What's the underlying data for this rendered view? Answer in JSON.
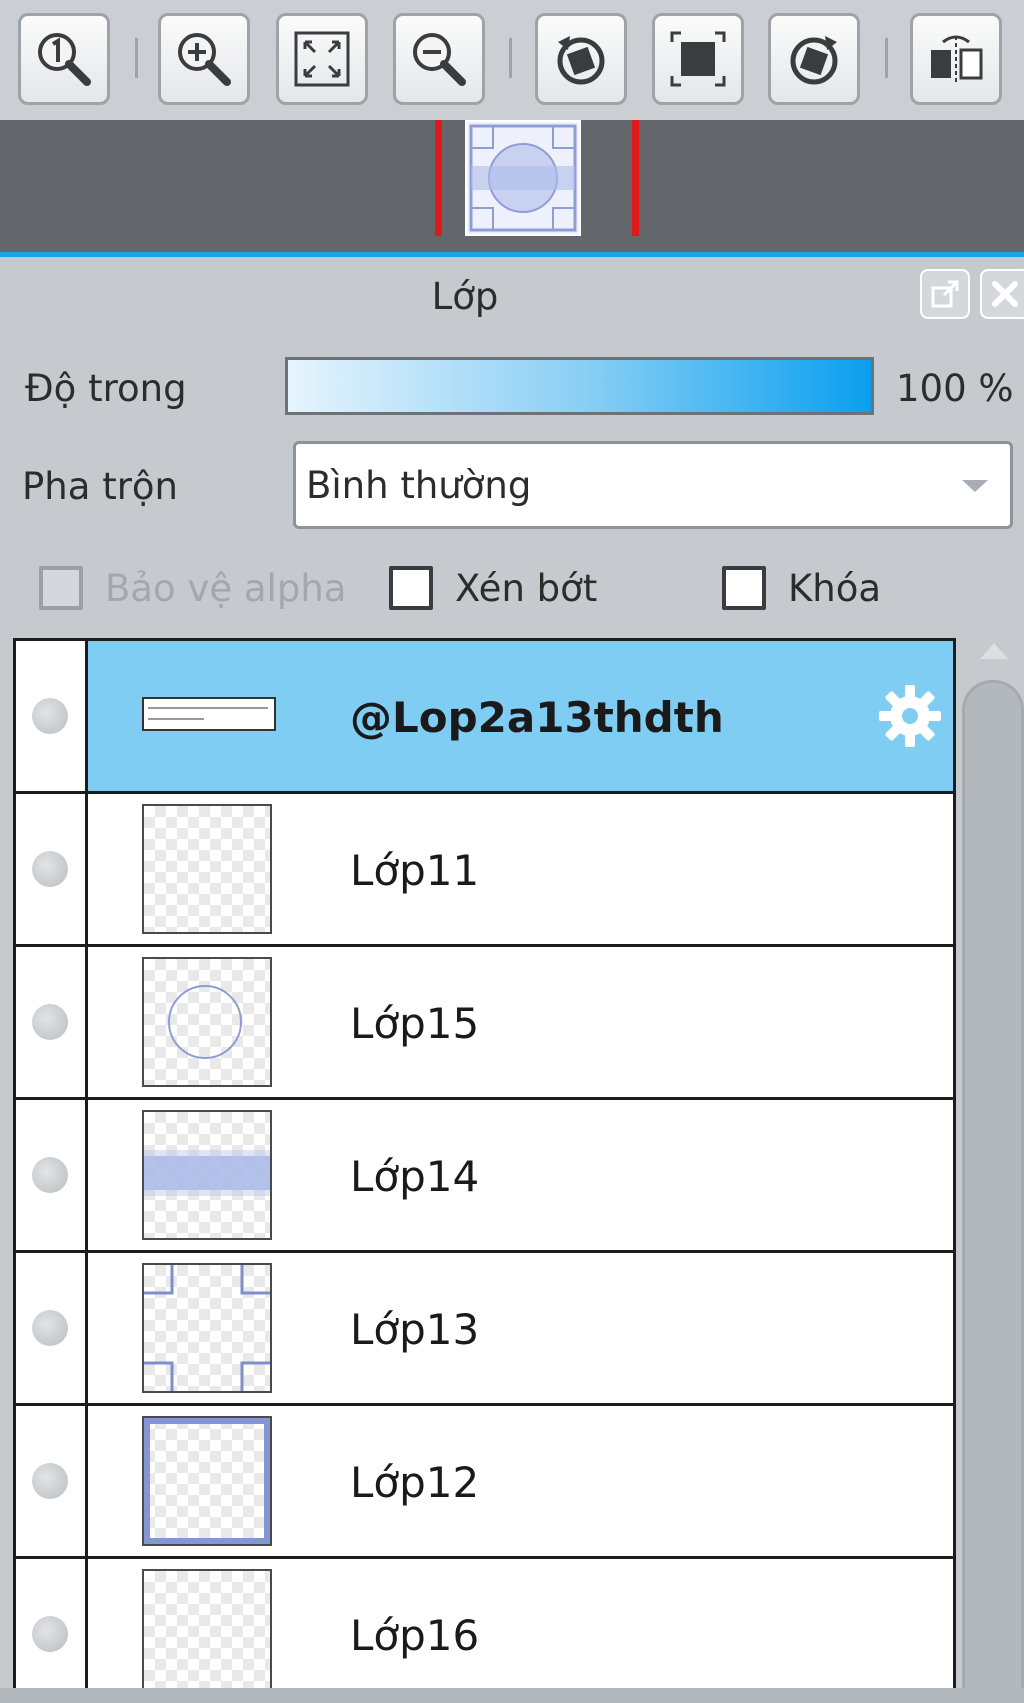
{
  "toolbar": {
    "buttons": [
      {
        "name": "zoom-actual-size-icon"
      },
      {
        "name": "zoom-in-icon"
      },
      {
        "name": "fit-to-window-icon"
      },
      {
        "name": "zoom-out-icon"
      },
      {
        "name": "rotate-left-icon"
      },
      {
        "name": "reset-rotation-icon"
      },
      {
        "name": "rotate-right-icon"
      },
      {
        "name": "flip-horizontal-icon"
      }
    ]
  },
  "panel": {
    "title": "Lớp",
    "opacity_label": "Độ trong",
    "opacity_value": "100 %",
    "opacity_fraction": 1.0,
    "blend_label": "Pha trộn",
    "blend_value": "Bình thường",
    "protect_alpha_label": "Bảo vệ alpha",
    "clip_label": "Xén bớt",
    "lock_label": "Khóa"
  },
  "colors": {
    "selected_row": "#7fcdf3",
    "accent_blue": "#1aa3e8",
    "marker_red": "#e0191d"
  },
  "layers": [
    {
      "name": "@Lop2a13thdth",
      "selected": true,
      "thumb": "text-thumb"
    },
    {
      "name": "Lớp11",
      "selected": false,
      "thumb": "empty"
    },
    {
      "name": "Lớp15",
      "selected": false,
      "thumb": "circle"
    },
    {
      "name": "Lớp14",
      "selected": false,
      "thumb": "band"
    },
    {
      "name": "Lớp13",
      "selected": false,
      "thumb": "corners"
    },
    {
      "name": "Lớp12",
      "selected": false,
      "thumb": "frame"
    },
    {
      "name": "Lớp16",
      "selected": false,
      "thumb": "empty"
    }
  ]
}
